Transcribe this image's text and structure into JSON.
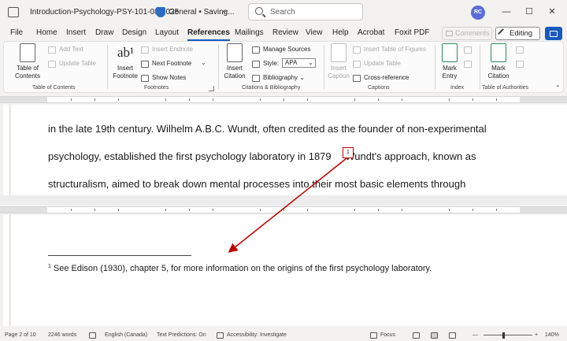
{
  "titlebar": {
    "doc_name": "Introduction-Psychology-PSY-101-08-2025",
    "sensitivity": "General",
    "status": "Saving...",
    "search_placeholder": "Search",
    "avatar_initials": "RC"
  },
  "tabs": [
    "File",
    "Home",
    "Insert",
    "Draw",
    "Design",
    "Layout",
    "References",
    "Mailings",
    "Review",
    "View",
    "Help",
    "Acrobat",
    "Foxit PDF"
  ],
  "active_tab": "References",
  "right_controls": {
    "comments": "Comments",
    "editing": "Editing"
  },
  "ribbon": {
    "toc": {
      "table_of_contents": "Table of\nContents",
      "add_text": "Add Text",
      "update_table": "Update Table",
      "group": "Table of Contents"
    },
    "footnotes": {
      "insert_footnote": "Insert\nFootnote",
      "insert_endnote": "Insert Endnote",
      "next_footnote": "Next Footnote",
      "show_notes": "Show Notes",
      "group": "Footnotes"
    },
    "citations": {
      "insert_citation": "Insert\nCitation",
      "manage_sources": "Manage Sources",
      "style_label": "Style:",
      "style_value": "APA",
      "bibliography": "Bibliography",
      "group": "Citations & Bibliography"
    },
    "captions": {
      "insert_caption": "Insert\nCaption",
      "insert_table_of_figures": "Insert Table of Figures",
      "update_table": "Update Table",
      "cross_reference": "Cross-reference",
      "group": "Captions"
    },
    "index": {
      "mark_entry": "Mark\nEntry",
      "group": "Index"
    },
    "authorities": {
      "mark_citation": "Mark\nCitation",
      "group": "Table of Authorities"
    }
  },
  "document": {
    "line1": "in the late 19th century. Wilhelm A.B.C. Wundt, often credited as the founder of non-experimental",
    "line2_before": "psychology, established the first psychology laboratory in 1879",
    "footnote_marker": "1",
    "line2_after": " Wundt's approach, known as",
    "line3": "structuralism, aimed to break down mental processes into their most basic elements through",
    "footnote_number": "1",
    "footnote_text": "See Edison (1930), chapter 5, for more information on the origins of the first psychology laboratory."
  },
  "statusbar": {
    "page": "Page 2 of 10",
    "words": "2246 words",
    "language": "English (Canada)",
    "text_predictions": "Text Predictions: On",
    "accessibility": "Accessibility: Investigate",
    "focus": "Focus",
    "zoom": "140%"
  },
  "colors": {
    "accent": "#185abd",
    "annotation_red": "#c00000"
  }
}
